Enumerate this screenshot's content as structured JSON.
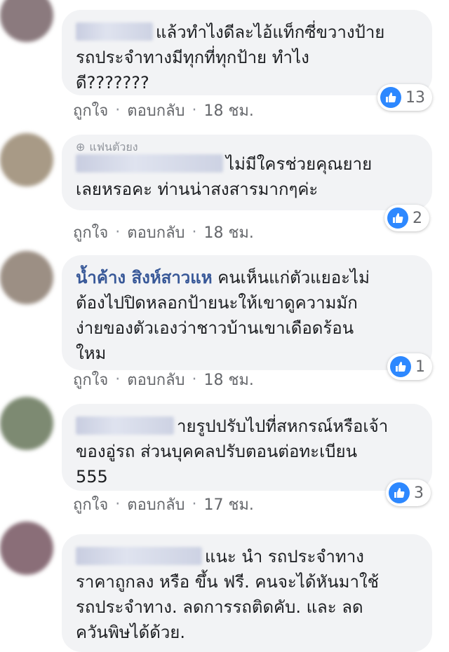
{
  "comments": [
    {
      "author": "",
      "fan_label": "",
      "text": "แล้วทำไงดีละไอ้แท็กซี่ขวางป้าย\nรถประจำทางมีทุกที่ทุกป้าย ทำไง\nดี???????",
      "reactions": "13",
      "like": "ถูกใจ",
      "reply": "ตอบกลับ",
      "time": "18 ชม."
    },
    {
      "author": "",
      "fan_label": "แฟนตัวยง",
      "text": "ไม่มีใครช่วยคุณยาย\nเลยหรอคะ ท่านน่าสงสารมากๆค่ะ",
      "reactions": "2",
      "like": "ถูกใจ",
      "reply": "ตอบกลับ",
      "time": "18 ชม."
    },
    {
      "author": "น้ำค้าง สิงห์สาวแห",
      "fan_label": "",
      "text": "คนเห็นแก่ตัวแยอะไม่\nต้องไปปิดหลอกป้ายนะให้เขาดูความมัก\nง่ายของตัวเองว่าชาวบ้านเขาเดือดร้อน\nใหม",
      "reactions": "1",
      "like": "ถูกใจ",
      "reply": "ตอบกลับ",
      "time": "18 ชม."
    },
    {
      "author": "",
      "fan_label": "",
      "text": "ายรูปปรับไปที่สหกรณ์หรือเจ้า\nของอู่รถ ส่วนบุคคลปรับตอนต่อทะเบียน\n555",
      "reactions": "3",
      "like": "ถูกใจ",
      "reply": "ตอบกลับ",
      "time": "17 ชม."
    },
    {
      "author": "",
      "fan_label": "",
      "text": "แนะ นำ รถประจำทาง\nราคาถูกลง หรือ ขึ้น ฟรี. คนจะได้หันมาใช้\nรถประจำทาง. ลดการรถติดคับ. และ ลด\nควันพิษได้ด้วย.",
      "reactions": "",
      "like": "",
      "reply": "",
      "time": ""
    }
  ],
  "colors": {
    "author": "#385898",
    "bubble": "#f2f3f5",
    "like": "#2d88ff"
  }
}
